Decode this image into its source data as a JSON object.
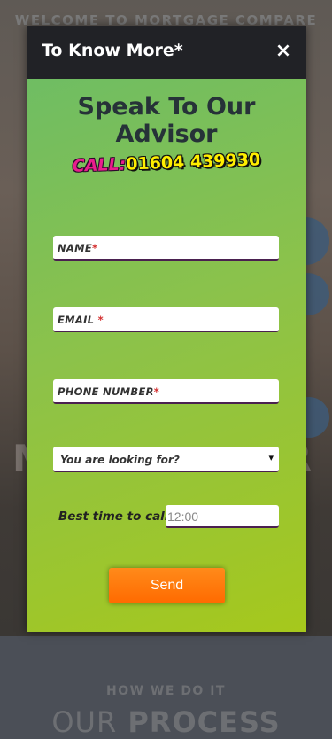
{
  "background": {
    "welcome_text": "WELCOME TO MORTGAGE COMPARE",
    "how_text": "HOW WE DO IT",
    "our_text": "OUR",
    "process_text": "PROCESS",
    "big_left": "M",
    "big_right": "R"
  },
  "modal": {
    "title": "To Know More*",
    "close_symbol": "×",
    "heading": "Speak To Our Advisor",
    "call_label": "CALL:",
    "call_number": "01604 439930",
    "fields": {
      "name_label": "NAME",
      "email_label": "EMAIL",
      "phone_label": "PHONE NUMBER",
      "required_mark": "*"
    },
    "select": {
      "selected": "You are looking for?",
      "caret": "▾"
    },
    "time": {
      "label": "Best time to call",
      "value": "12:00"
    },
    "send_label": "Send"
  },
  "colors": {
    "header_bg": "#212226",
    "gradient_start": "#6fbd63",
    "gradient_end": "#a6c81c",
    "call_label": "#e91e8c",
    "call_number": "#ffee00",
    "send_button": "#ff7a00"
  }
}
